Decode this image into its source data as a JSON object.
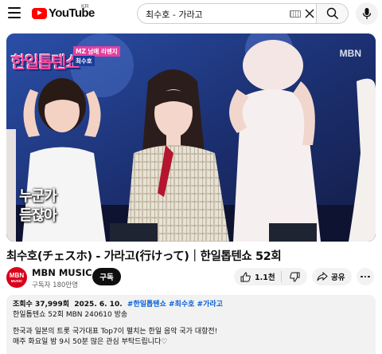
{
  "header": {
    "logo_text": "YouTube",
    "region": "KR",
    "search_value": "최수호 - 가라고",
    "icons": [
      "menu-icon",
      "keyboard-icon",
      "clear-icon",
      "search-icon",
      "mic-icon"
    ]
  },
  "player": {
    "show_logo": "한일톱텐쇼",
    "badge_top": "MZ 남매 리벤지",
    "badge_name": "최수호",
    "watermark": "MBN",
    "subtitle_line1": "누군가",
    "subtitle_line2": "듣잖아"
  },
  "video": {
    "title": "최수호(チェスホ) - 가라고(行けって)｜한일톱텐쇼 52회"
  },
  "channel": {
    "name": "MBN MUSIC",
    "subscribers": "구독자 180만명",
    "avatar_text": "MBN",
    "avatar_sub": "MUSIC",
    "subscribe_label": "구독"
  },
  "actions": {
    "likes": "1.1천",
    "share_label": "공유"
  },
  "description": {
    "views": "조회수 37,999회",
    "date": "2025. 6. 10.",
    "tags": [
      "#한일톱텐쇼",
      "#최수호",
      "#가라고"
    ],
    "line1": "한일톱텐쇼 52회 MBN 240610 방송",
    "line2": "한국과 일본의 트롯 국가대표 Top7이 펼치는 한일 음악 국가 대항전!",
    "line3": "매주 화요일 밤 9시 50분 많은 관심 부탁드립니다♡"
  },
  "colors": {
    "brand_red": "#ff0000",
    "link_blue": "#065fd4",
    "chip_bg": "#f2f2f2",
    "subscribe_bg": "#0f0f0f"
  }
}
